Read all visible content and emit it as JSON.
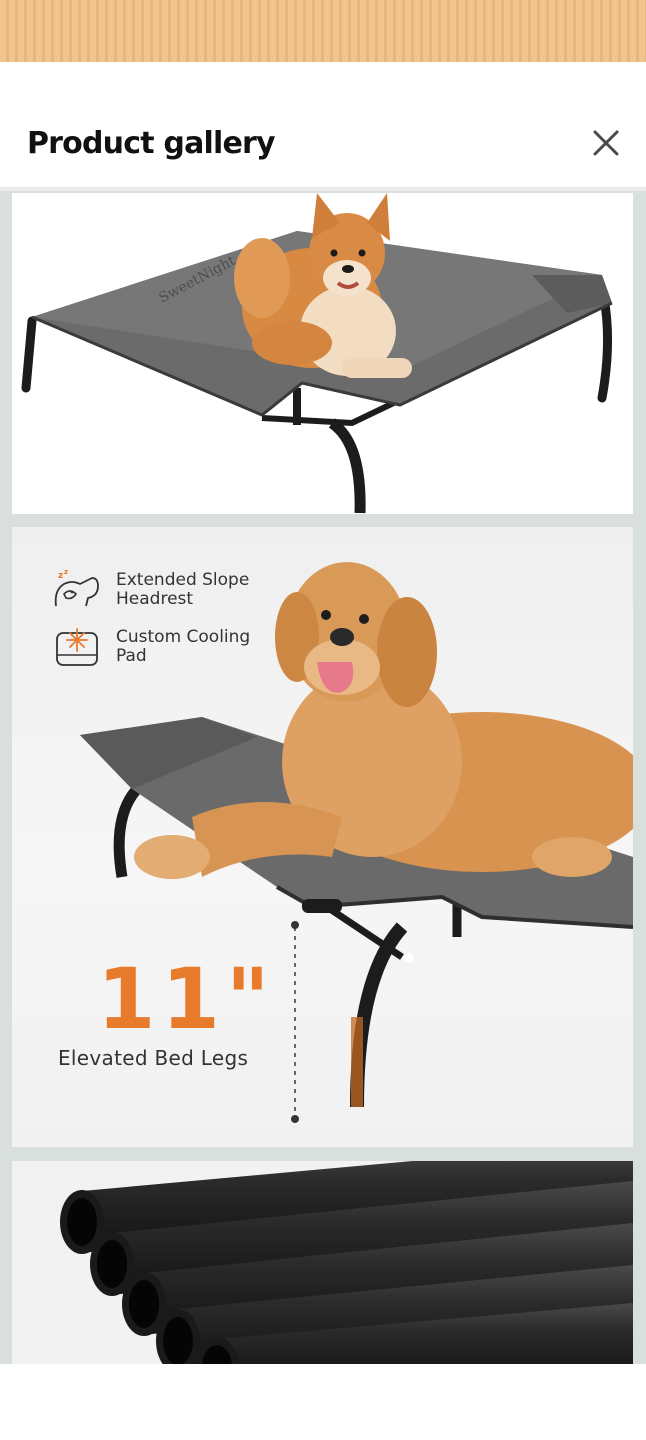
{
  "header": {
    "title": "Product gallery",
    "close_icon": "close-icon"
  },
  "gallery": {
    "images": [
      {
        "subject": "Shiba Inu lying on gray elevated dog cot",
        "bed_print": "SweetNight"
      },
      {
        "subject": "Golden Retriever lying on gray elevated dog cot",
        "features": [
          {
            "icon": "dog-headrest-icon",
            "label": "Extended Slope Headrest"
          },
          {
            "icon": "snowflake-pad-icon",
            "label": "Custom Cooling Pad"
          }
        ],
        "height_value": "11\"",
        "height_caption": "Elevated Bed Legs"
      },
      {
        "subject": "Close-up of black steel tube frame legs"
      }
    ]
  },
  "colors": {
    "accent_orange": "#e87a2b",
    "gallery_background": "#d9dfdd",
    "bed_fabric_gray": "#6a6a6a"
  }
}
